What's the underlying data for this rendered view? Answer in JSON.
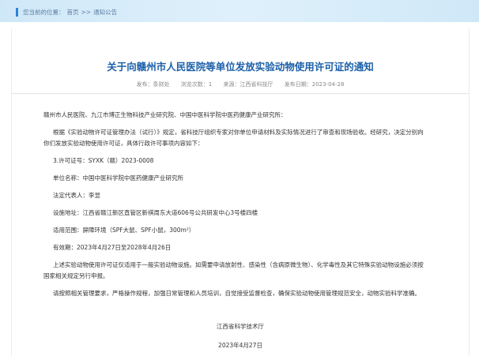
{
  "breadcrumb": {
    "prefix": "您当前的位置：",
    "home": "首页",
    "sep": ">>",
    "section": "通知公告"
  },
  "article": {
    "title": "关于向赣州市人民医院等单位发放实验动物使用许可证的通知",
    "meta": {
      "publisher": "发布：条财处",
      "views": "浏览次数：1",
      "source": "来源：江西省科技厅",
      "date": "发布日期：2023-04-28"
    },
    "paragraphs": {
      "salutation": "赣州市人民医院、九江市博正生物科技产业研究院、中国中医科学院中医药健康产业研究所：",
      "intro_1": "根据《实验动物许可证管理办法（试行）》规定，省科技厅组织专家对你单位申请材料及实际情况进行了审查和现场验收。经研究，决定分别向",
      "intro_2": "你们发放实验动物使用许可证，具体行政许可事项内容如下：",
      "license_no": "3.许可证号：SYXK（赣）2023-0008",
      "unit": "单位名称：中国中医科学院中医药健康产业研究所",
      "rep": "法定代表人：李显",
      "address": "设施地址：江西省赣江新区直管区新祺周东大道606号公共研发中心3号楼四楼",
      "scope": "适用范围：屏障环境（SPF大鼠、SPF小鼠，300m²）",
      "valid": "有效期：2023年4月27日至2028年4月26日",
      "note_1": "上述实验动物使用许可证仅适用于一般实验动物设施。如需要申请放射性、感染性（含病原微生物）、化学毒性及其它特殊实验动物设施必须按",
      "note_2": "国家相关规定另行申报。",
      "closing": "请按照相关管理要求，严格操作规程，加强日常管理和人员培训，自觉接受监督检查，确保实验动物使用管理规范安全，动物实验科学准确。"
    },
    "signature": {
      "org": "江西省科学技术厅",
      "date": "2023年4月27日"
    }
  }
}
